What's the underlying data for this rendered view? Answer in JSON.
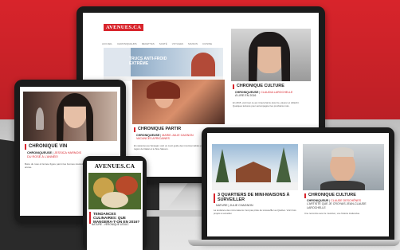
{
  "brand": "AVENUES.CA",
  "brand_color": "#d8242b",
  "desktop": {
    "nav": [
      "Accueil",
      "Chroniqueurs",
      "Recettes",
      "Santé",
      "Voyages",
      "Maison",
      "Cuisine"
    ],
    "banner": "TRUCS ANTI-FROID EXTRÊME",
    "card_right": {
      "kicker": "CHRONIQUE CULTURE",
      "label": "CHRONIQUEUSE",
      "author": "CLAUDIA LAROCHELLE",
      "sub": "À LIRE EN 2016",
      "text": "En 2015, voici tout ce qui m'aura fait le plus rire, pleurer et réfléchir. Quelques lectures pour accompagner les prochains mois."
    },
    "card_left": {
      "kicker": "CHRONIQUE PARTIR",
      "label": "CHRONIQUEUSE",
      "author": "MARIE-JULIE GAGNON",
      "sub": "VACANCES AFRICAINES",
      "text": "En vacances au Sénégal, voici un court guide des incontournables pour découvrir la région de Dakar et le Sine Saloum."
    }
  },
  "tablet": {
    "kicker": "CHRONIQUE VIN",
    "label": "CHRONIQUEUSE",
    "author": "JESSICA HARNOIS",
    "sub": "DU ROSÉ À L'ANNÉE!",
    "text": "Boire du rosé à l'année figure parmi les bonnes résolutions à prendre pour la nouvelle année."
  },
  "phone": {
    "brand": "AVENUES.CA",
    "kicker": "TENDANCES CULINAIRES: QUE MANGERA-T-ON EN 2016?",
    "meta": "NATURE - VÉRONIQUE LEDUC"
  },
  "laptop": {
    "card_left": {
      "kicker": "3 QUARTIERS DE MINI-MAISONS À SURVEILLER",
      "meta": "NATURE | JULIE CHAGNON",
      "text": "La tendance des mini-maisons n'est pas prête de s'essouffler au Québec. Voici trois projets à surveiller."
    },
    "card_right": {
      "kicker": "CHRONIQUE CULTURE",
      "label": "CHRONIQUEUR",
      "author": "CLAUDE DESCHÊNES",
      "sub": "L'ARTISTE QUE JE CROYAIS JEAN-CLAUDE LAROCHELLE",
      "text": "Une rencontre avec le musicien, une histoire inattendue."
    }
  }
}
